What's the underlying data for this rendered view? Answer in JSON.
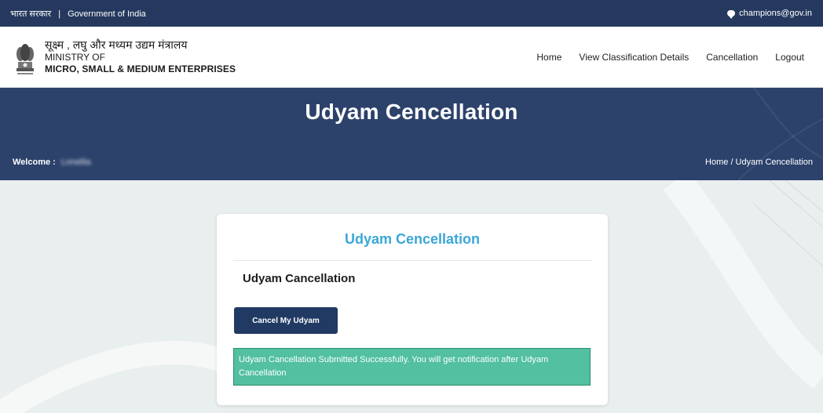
{
  "topbar": {
    "hindi_gov": "भारत सरकार",
    "separator": "|",
    "english_gov": "Government of India",
    "contact_icon": "chat-icon",
    "contact_email": "champions@gov.in"
  },
  "header": {
    "emblem_icon": "national-emblem-icon",
    "ministry_hindi": "सूक्ष्म , लघु और मध्यम उद्यम मंत्रालय",
    "ministry_of": "MINISTRY OF",
    "ministry_name": "MICRO, SMALL & MEDIUM ENTERPRISES"
  },
  "nav": {
    "items": [
      {
        "label": "Home"
      },
      {
        "label": "View Classification Details"
      },
      {
        "label": "Cancellation"
      },
      {
        "label": "Logout"
      }
    ]
  },
  "banner": {
    "title": "Udyam Cencellation",
    "welcome_label": "Welcome :",
    "welcome_name": "Lonellia",
    "breadcrumb": "Home / Udyam Cencellation"
  },
  "card": {
    "title": "Udyam Cencellation",
    "subtitle": "Udyam Cancellation",
    "button_label": "Cancel My Udyam",
    "alert_message": "Udyam Cancellation Submitted Successfully. You will get notification after Udyam Cancellation"
  },
  "colors": {
    "primary_navy": "#25395f",
    "banner": "#2c426b",
    "accent_blue": "#3aa7d7",
    "success": "#52c0a1"
  }
}
